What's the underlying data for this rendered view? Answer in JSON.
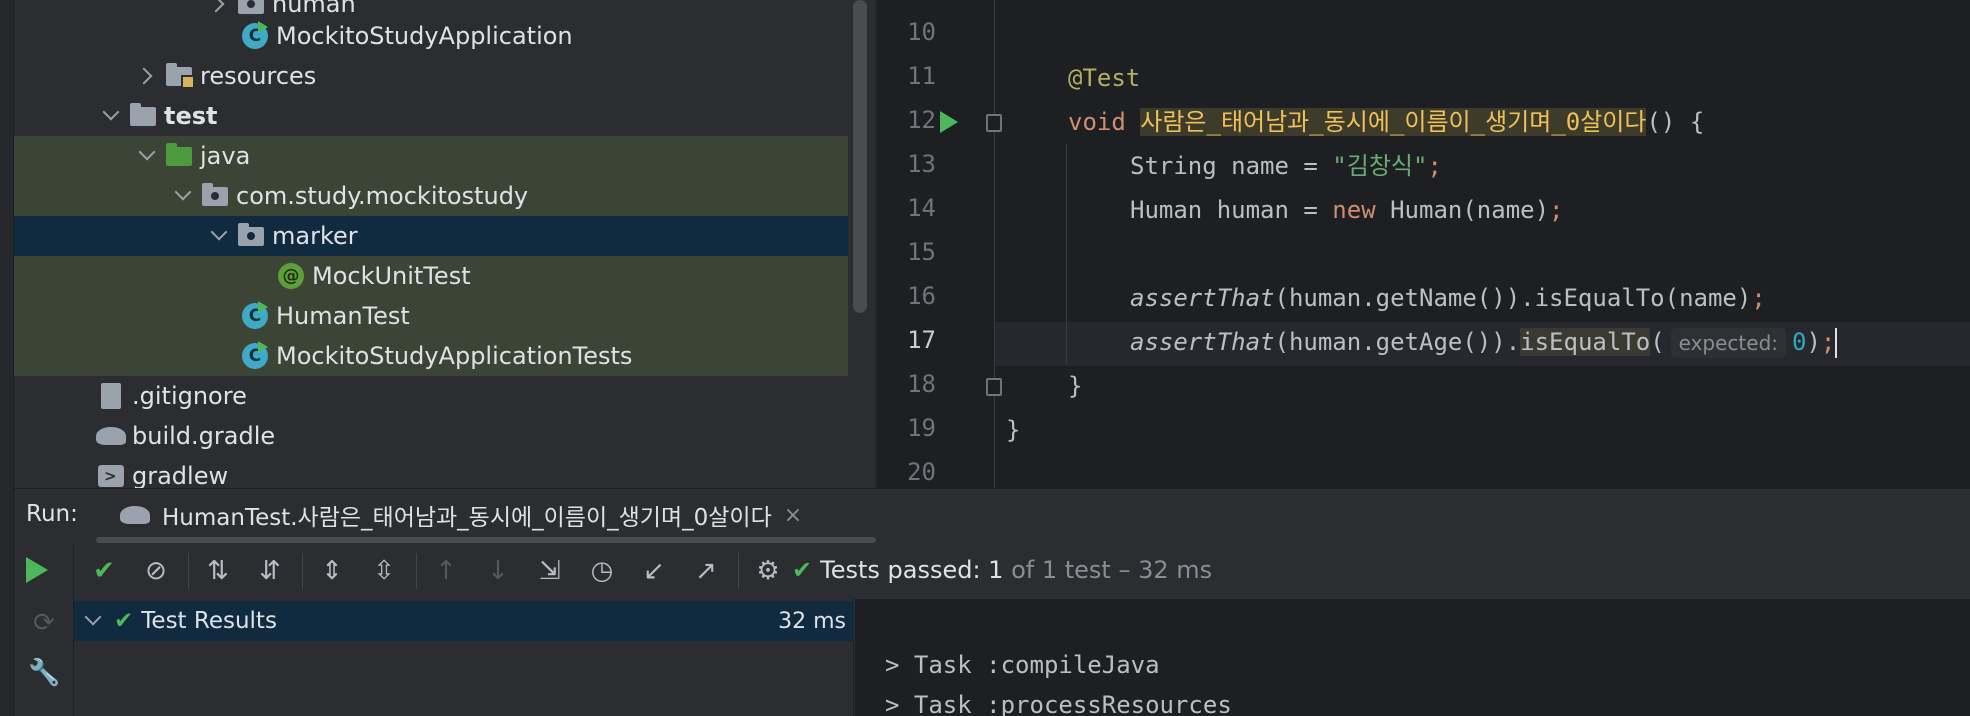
{
  "project_tree": {
    "rows": [
      {
        "label": "human",
        "icon": "folder-icon"
      },
      {
        "label": "MockitoStudyApplication",
        "icon": "spring-class-icon"
      },
      {
        "label": "resources",
        "icon": "resources-folder-icon"
      },
      {
        "label": "test",
        "icon": "folder-icon"
      },
      {
        "label": "java",
        "icon": "test-folder-icon"
      },
      {
        "label": "com.study.mockitostudy",
        "icon": "package-icon"
      },
      {
        "label": "marker",
        "icon": "package-icon"
      },
      {
        "label": "MockUnitTest",
        "icon": "annotation-icon",
        "glyph": "@"
      },
      {
        "label": "HumanTest",
        "icon": "test-class-icon",
        "glyph": "C"
      },
      {
        "label": "MockitoStudyApplicationTests",
        "icon": "test-class-icon",
        "glyph": "C"
      },
      {
        "label": ".gitignore",
        "icon": "file-icon"
      },
      {
        "label": "build.gradle",
        "icon": "gradle-icon"
      },
      {
        "label": "gradlew",
        "icon": "terminal-file-icon"
      }
    ]
  },
  "editor": {
    "line_numbers": [
      "10",
      "11",
      "12",
      "13",
      "14",
      "15",
      "16",
      "17",
      "18",
      "19",
      "20"
    ],
    "current_line": "17",
    "code": {
      "annotation": "@Test",
      "void_kw": "void",
      "method_name": "사람은_태어남과_동시에_이름이_생기며_0살이다",
      "method_tail": "() {",
      "l13_type": "String name = ",
      "l13_str": "\"김창식\"",
      "l13_semi": ";",
      "l14_a": "Human human = ",
      "l14_new": "new",
      "l14_b": " Human(name)",
      "l14_semi": ";",
      "l16_assert": "assertThat",
      "l16_rest": "(human.getName()).isEqualTo(name)",
      "l16_semi": ";",
      "l17_assert": "assertThat",
      "l17_mid": "(human.getAge()).",
      "l17_call": "isEqualTo",
      "l17_paren": "(",
      "l17_hint": "expected:",
      "l17_num": "0",
      "l17_close": ")",
      "l17_semi": ";",
      "l18": "}",
      "l19": "}"
    }
  },
  "run_panel": {
    "label": "Run:",
    "tab_title": "HumanTest.사람은_태어남과_동시에_이름이_생기며_0살이다",
    "tab_close": "×",
    "status_main": "Tests passed: 1",
    "status_dim": " of 1 test – 32 ms",
    "results_root": "Test Results",
    "results_time": "32 ms",
    "console": [
      "> Task :compileJava",
      "> Task :processResources"
    ]
  },
  "colors": {
    "accent_green": "#4fb75b",
    "selection_blue": "#102a3f",
    "test_source_bg": "#3c4436"
  }
}
